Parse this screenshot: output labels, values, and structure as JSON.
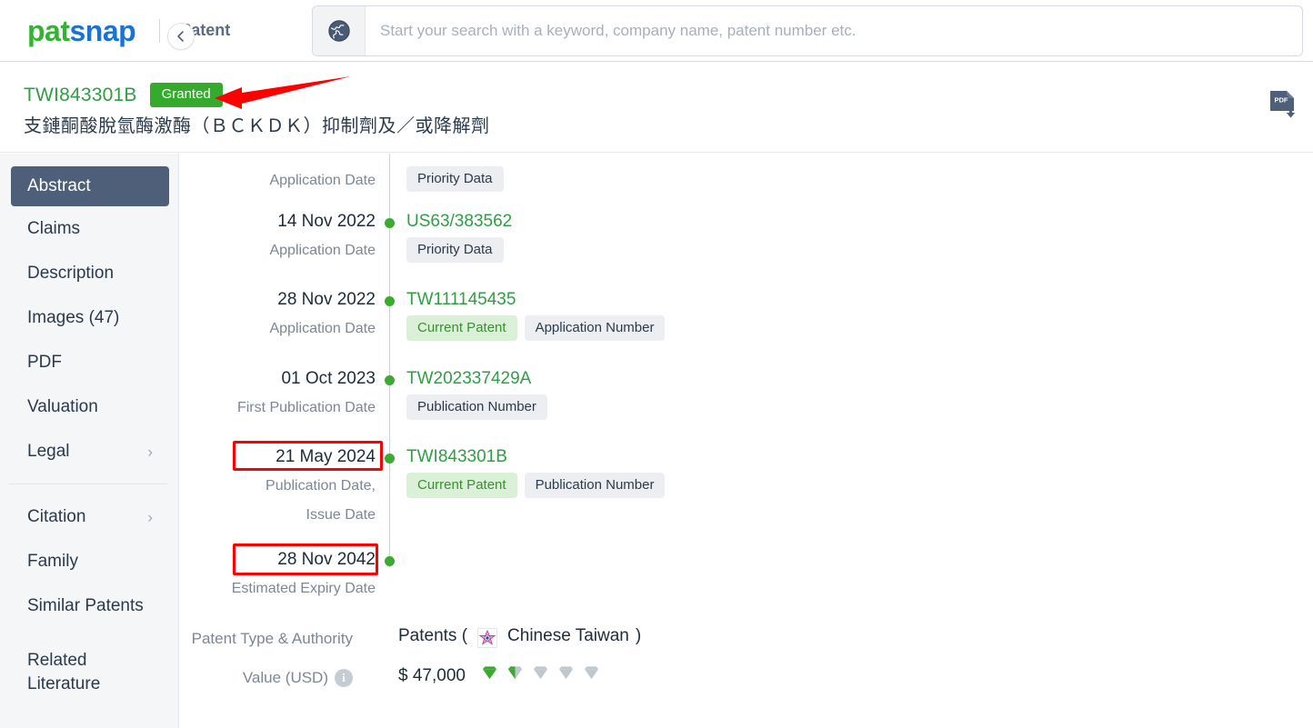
{
  "topbar": {
    "logo_pat": "pat",
    "logo_snap": "snap",
    "module": "Patent",
    "search_placeholder": "Start your search with a keyword, company name, patent number etc.",
    "search_value": "",
    "globe_icon": "globe-icon"
  },
  "patent_header": {
    "number": "TWI843301B",
    "status_badge": "Granted",
    "title": "支鏈酮酸脫氫酶激酶（ＢＣＫＤＫ）抑制劑及／或降解劑",
    "pdf_icon": "pdf-download-icon"
  },
  "sidebar": {
    "collapse_icon": "chevron-left-icon",
    "items": [
      {
        "label": "Abstract",
        "active": true,
        "chevron": false
      },
      {
        "label": "Claims",
        "active": false,
        "chevron": false
      },
      {
        "label": "Description",
        "active": false,
        "chevron": false
      },
      {
        "label": "Images (47)",
        "active": false,
        "chevron": false
      },
      {
        "label": "PDF",
        "active": false,
        "chevron": false
      },
      {
        "label": "Valuation",
        "active": false,
        "chevron": false
      },
      {
        "label": "Legal",
        "active": false,
        "chevron": true
      }
    ],
    "items2": [
      {
        "label": "Citation",
        "active": false,
        "chevron": true
      },
      {
        "label": "Family",
        "active": false,
        "chevron": false
      },
      {
        "label": "Similar Patents",
        "active": false,
        "chevron": false
      },
      {
        "label": "Related Literature",
        "active": false,
        "chevron": false,
        "multiline": [
          "Related",
          "Literature"
        ]
      }
    ]
  },
  "timeline": {
    "rows": [
      {
        "date": "",
        "sublabel": "Application Date",
        "number": "",
        "tags": [
          "Priority Data"
        ],
        "highlight": false,
        "partial": true
      },
      {
        "date": "14 Nov 2022",
        "sublabel": "Application Date",
        "number": "US63/383562",
        "tags": [
          "Priority Data"
        ],
        "highlight": false
      },
      {
        "date": "28 Nov 2022",
        "sublabel": "Application Date",
        "number": "TW111145435",
        "tags": [
          "Current Patent",
          "Application Number"
        ],
        "tag_green_index": 0,
        "highlight": false
      },
      {
        "date": "01 Oct 2023",
        "sublabel": "First Publication Date",
        "number": "TW202337429A",
        "tags": [
          "Publication Number"
        ],
        "highlight": false
      },
      {
        "date": "21 May 2024",
        "sublabel": "Publication Date,",
        "sublabel2": "Issue Date",
        "number": "TWI843301B",
        "tags": [
          "Current Patent",
          "Publication Number"
        ],
        "tag_green_index": 0,
        "highlight": true
      },
      {
        "date": "28 Nov 2042",
        "sublabel": "Estimated Expiry Date",
        "number": "",
        "tags": [],
        "highlight": true
      }
    ]
  },
  "details": {
    "type_label": "Patent Type & Authority",
    "type_value_prefix": "Patents (",
    "type_authority": "Chinese Taiwan",
    "type_value_suffix": ")",
    "authority_icon": "taiwan-emblem-icon",
    "value_label": "Value (USD)",
    "value_info_icon": "info-icon",
    "value_amount": "$ 47,000",
    "value_rating": 1.5,
    "value_rating_max": 5
  },
  "annotations": {
    "arrow": "red-arrow-pointing-to-granted-badge",
    "highlight_boxes": [
      "21 May 2024",
      "28 Nov 2042"
    ]
  },
  "colors": {
    "brand_green": "#34b233",
    "brand_blue": "#1a73d4",
    "granted_green": "#35ab2e",
    "link_green": "#2f9e44",
    "sidebar_active": "#4e5f79",
    "annotation_red": "#ff0000",
    "gem_green": "#3aab2f",
    "gem_gray": "#bfc7cf"
  }
}
